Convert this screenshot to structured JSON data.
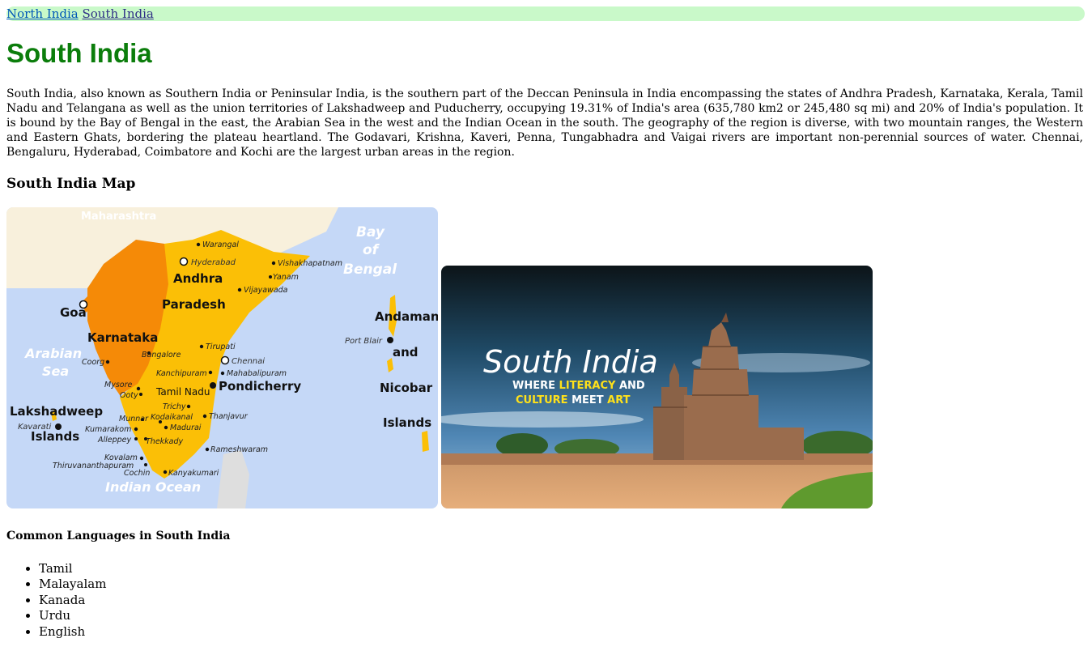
{
  "nav": {
    "links": [
      {
        "label": "North India"
      },
      {
        "label": "South India"
      }
    ]
  },
  "page_title": "South India",
  "intro": "South India, also known as Southern India or Peninsular India, is the southern part of the Deccan Peninsula in India encompassing the states of Andhra Pradesh, Karnataka, Kerala, Tamil Nadu and Telangana as well as the union territories of Lakshadweep and Puducherry, occupying 19.31% of India's area (635,780 km2 or 245,480 sq mi) and 20% of India's population. It is bound by the Bay of Bengal in the east, the Arabian Sea in the west and the Indian Ocean in the south. The geography of the region is diverse, with two mountain ranges, the Western and Eastern Ghats, bordering the plateau heartland. The Godavari, Krishna, Kaveri, Penna, Tungabhadra and Vaigai rivers are important non-perennial sources of water. Chennai, Bengaluru, Hyderabad, Coimbatore and Kochi are the largest urban areas in the region.",
  "map_section": {
    "heading": "South India Map",
    "map_labels": {
      "maharashtra": "Maharashtra",
      "bay_line1": "Bay",
      "bay_line2": "of",
      "bay_line3": "Bengal",
      "arabian_line1": "Arabian",
      "arabian_line2": "Sea",
      "indian_ocean": "Indian Ocean",
      "andhra": "Andhra",
      "paradesh": "Paradesh",
      "karnataka": "Karnataka",
      "tamil_nadu": "Tamil Nadu",
      "goa": "Goa",
      "lakshadweep": "Lakshadweep",
      "islands_west": "Islands",
      "andaman": "Andaman",
      "and": "and",
      "nicobar": "Nicobar",
      "islands_east": "Islands",
      "pondicherry": "Pondicherry",
      "hyderabad": "Hyderabad",
      "chennai": "Chennai",
      "port_blair": "Port Blair",
      "kavarati": "Kavarati",
      "warangal": "Warangal",
      "vishakhapatnam": "Vishakhapatnam",
      "yanam": "Yanam",
      "vijayawada": "Vijayawada",
      "tirupati": "Tirupati",
      "bangalore": "Bangalore",
      "coorg": "Coorg",
      "kanchipuram": "Kanchipuram",
      "mahabalipuram": "Mahabalipuram",
      "mysore": "Mysore",
      "ooty": "Ooty",
      "trichy": "Trichy",
      "munnar": "Munnar",
      "kodaikanal": "Kodaikanal",
      "thanjavur": "Thanjavur",
      "kumarakom": "Kumarakom",
      "madurai": "Madurai",
      "alleppey": "Alleppey",
      "thekkady": "Thekkady",
      "rameshwaram": "Rameshwaram",
      "kovalam": "Kovalam",
      "thiruvananthapuram": "Thiruvananthapuram",
      "cochin": "Cochin",
      "kanyakumari": "Kanyakumari"
    },
    "banner": {
      "script_title": "South India",
      "tagline_1a": "WHERE ",
      "tagline_1b": "LITERACY",
      "tagline_1c": " AND",
      "tagline_2a": "CULTURE",
      "tagline_2b": " MEET ",
      "tagline_2c": "ART"
    }
  },
  "languages": {
    "heading": "Common Languages in South India",
    "items": [
      "Tamil",
      "Malayalam",
      "Kanada",
      "Urdu",
      "English"
    ]
  },
  "colors": {
    "nav_bg": "#c9f9c9",
    "title_green": "#0b7d0b",
    "map_sea": "#c5d8f7",
    "map_orange": "#f58a07",
    "map_yellow": "#fbbf06",
    "banner_accent": "#ffe11a"
  }
}
